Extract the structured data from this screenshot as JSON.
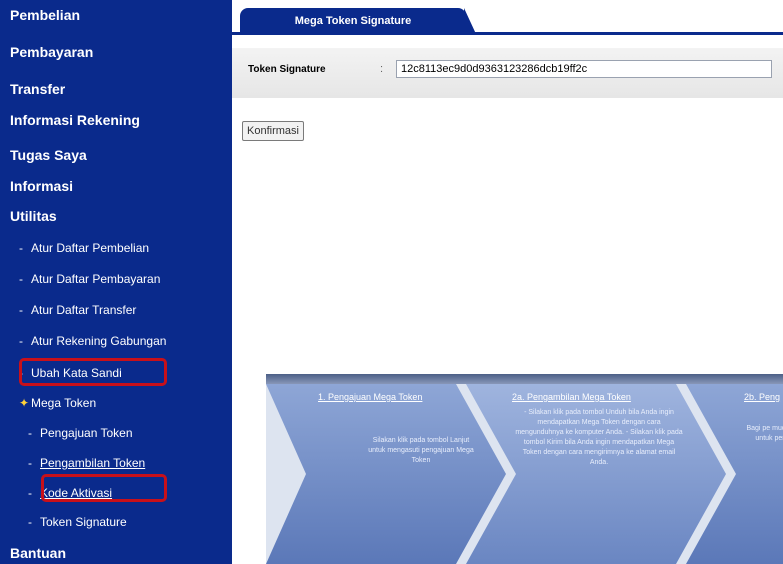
{
  "sidebar": {
    "menu": {
      "pembelian": "Pembelian",
      "pembayaran": "Pembayaran",
      "transfer": "Transfer",
      "informasi_rekening": "Informasi Rekening",
      "tugas_saya": "Tugas Saya",
      "informasi": "Informasi",
      "utilitas": "Utilitas",
      "bantuan": "Bantuan"
    },
    "utilitas_items": {
      "atur_daftar_pembelian": "Atur Daftar Pembelian",
      "atur_daftar_pembayaran": "Atur Daftar Pembayaran",
      "atur_daftar_transfer": "Atur Daftar Transfer",
      "atur_rekening_gabungan": "Atur Rekening Gabungan",
      "ubah_kata_sandi": "Ubah Kata Sandi",
      "mega_token": "Mega Token"
    },
    "mega_token_items": {
      "pengajuan_token": "Pengajuan Token",
      "pengambilan_token": "Pengambilan Token",
      "kode_aktivasi": "Kode Aktivasi",
      "token_signature": "Token Signature"
    },
    "bullet": "-",
    "star": "✦"
  },
  "main": {
    "tab_title": "Mega Token Signature",
    "field_label": "Token Signature",
    "field_colon": ":",
    "field_value": "12c8113ec9d0d9363123286dcb19ff2c",
    "confirm_label": "Konfirmasi"
  },
  "banner": {
    "step1_title": "1. Pengajuan Mega Token",
    "step1_text": "Silakan klik pada tombol Lanjut untuk mengasuti pengajuan Mega Token",
    "step2a_title": "2a. Pengambilan Mega Token",
    "step2a_text": "- Silakan klik pada tombol Unduh bila Anda ingin mendapatkan Mega Token dengan cara mengunduhnya ke komputer Anda. - Silakan klik pada tombol Kirim bila Anda ingin mendapatkan Mega Token dengan cara mengirimnya ke alamat email Anda.",
    "step2b_title": "2b. Peng",
    "step2b_text": "Bagi pe mudah untuk per"
  },
  "colors": {
    "sidebar_bg": "#0a2a8c",
    "highlight": "#c8101a",
    "star": "#ffd23a"
  }
}
